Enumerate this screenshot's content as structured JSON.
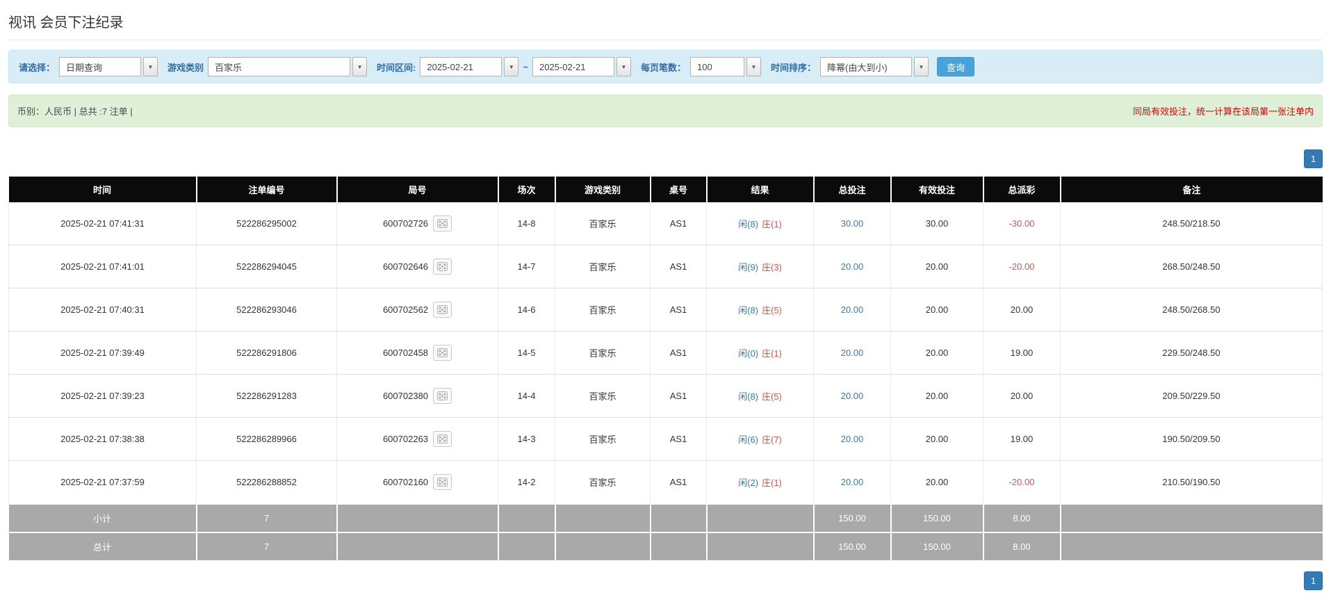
{
  "page": {
    "title": "视讯 会员下注纪录"
  },
  "filter": {
    "select_label": "请选择：",
    "select_value": "日期查询",
    "game_label": "游戏类别",
    "game_value": "百家乐",
    "range_label": "时间区间:",
    "date_from": "2025-02-21",
    "range_sep": "~",
    "date_to": "2025-02-21",
    "per_page_label": "每页笔数：",
    "per_page_value": "100",
    "sort_label": "时间排序：",
    "sort_value": "降幂(由大到小)",
    "search_label": "查询"
  },
  "summary": {
    "info": "币别：人民币 | 总共 :7 注单 |",
    "notice": "同局有效投注，统一计算在该局第一张注单内"
  },
  "pagination": {
    "page": "1"
  },
  "colors": {
    "accent_blue": "#337ab7",
    "negative_red": "#d9534f",
    "notice_red": "#e00000",
    "filter_bg": "#d9edf7",
    "summary_bg": "#dff0d8",
    "header_bg": "#0b0b0b",
    "footer_bg": "#a9a9a9",
    "search_button_bg": "#4aa3d8"
  },
  "table": {
    "headers": [
      "时间",
      "注单编号",
      "局号",
      "场次",
      "游戏类别",
      "桌号",
      "结果",
      "总投注",
      "有效投注",
      "总派彩",
      "备注"
    ],
    "rows": [
      {
        "time": "2025-02-21 07:41:31",
        "bet_id": "522286295002",
        "round": "600702726",
        "session": "14-8",
        "game": "百家乐",
        "table_no": "AS1",
        "result_player": "闲(8)",
        "result_banker": "庄(1)",
        "total_bet": "30.00",
        "valid_bet": "30.00",
        "payout": "-30.00",
        "note": "248.50/218.50"
      },
      {
        "time": "2025-02-21 07:41:01",
        "bet_id": "522286294045",
        "round": "600702646",
        "session": "14-7",
        "game": "百家乐",
        "table_no": "AS1",
        "result_player": "闲(9)",
        "result_banker": "庄(3)",
        "total_bet": "20.00",
        "valid_bet": "20.00",
        "payout": "-20.00",
        "note": "268.50/248.50"
      },
      {
        "time": "2025-02-21 07:40:31",
        "bet_id": "522286293046",
        "round": "600702562",
        "session": "14-6",
        "game": "百家乐",
        "table_no": "AS1",
        "result_player": "闲(8)",
        "result_banker": "庄(5)",
        "total_bet": "20.00",
        "valid_bet": "20.00",
        "payout": "20.00",
        "note": "248.50/268.50"
      },
      {
        "time": "2025-02-21 07:39:49",
        "bet_id": "522286291806",
        "round": "600702458",
        "session": "14-5",
        "game": "百家乐",
        "table_no": "AS1",
        "result_player": "闲(0)",
        "result_banker": "庄(1)",
        "total_bet": "20.00",
        "valid_bet": "20.00",
        "payout": "19.00",
        "note": "229.50/248.50"
      },
      {
        "time": "2025-02-21 07:39:23",
        "bet_id": "522286291283",
        "round": "600702380",
        "session": "14-4",
        "game": "百家乐",
        "table_no": "AS1",
        "result_player": "闲(8)",
        "result_banker": "庄(5)",
        "total_bet": "20.00",
        "valid_bet": "20.00",
        "payout": "20.00",
        "note": "209.50/229.50"
      },
      {
        "time": "2025-02-21 07:38:38",
        "bet_id": "522286289966",
        "round": "600702263",
        "session": "14-3",
        "game": "百家乐",
        "table_no": "AS1",
        "result_player": "闲(6)",
        "result_banker": "庄(7)",
        "total_bet": "20.00",
        "valid_bet": "20.00",
        "payout": "19.00",
        "note": "190.50/209.50"
      },
      {
        "time": "2025-02-21 07:37:59",
        "bet_id": "522286288852",
        "round": "600702160",
        "session": "14-2",
        "game": "百家乐",
        "table_no": "AS1",
        "result_player": "闲(2)",
        "result_banker": "庄(1)",
        "total_bet": "20.00",
        "valid_bet": "20.00",
        "payout": "-20.00",
        "note": "210.50/190.50"
      }
    ],
    "subtotal": {
      "label": "小计",
      "count": "7",
      "total_bet": "150.00",
      "valid_bet": "150.00",
      "payout": "8.00"
    },
    "total": {
      "label": "总计",
      "count": "7",
      "total_bet": "150.00",
      "valid_bet": "150.00",
      "payout": "8.00"
    }
  }
}
